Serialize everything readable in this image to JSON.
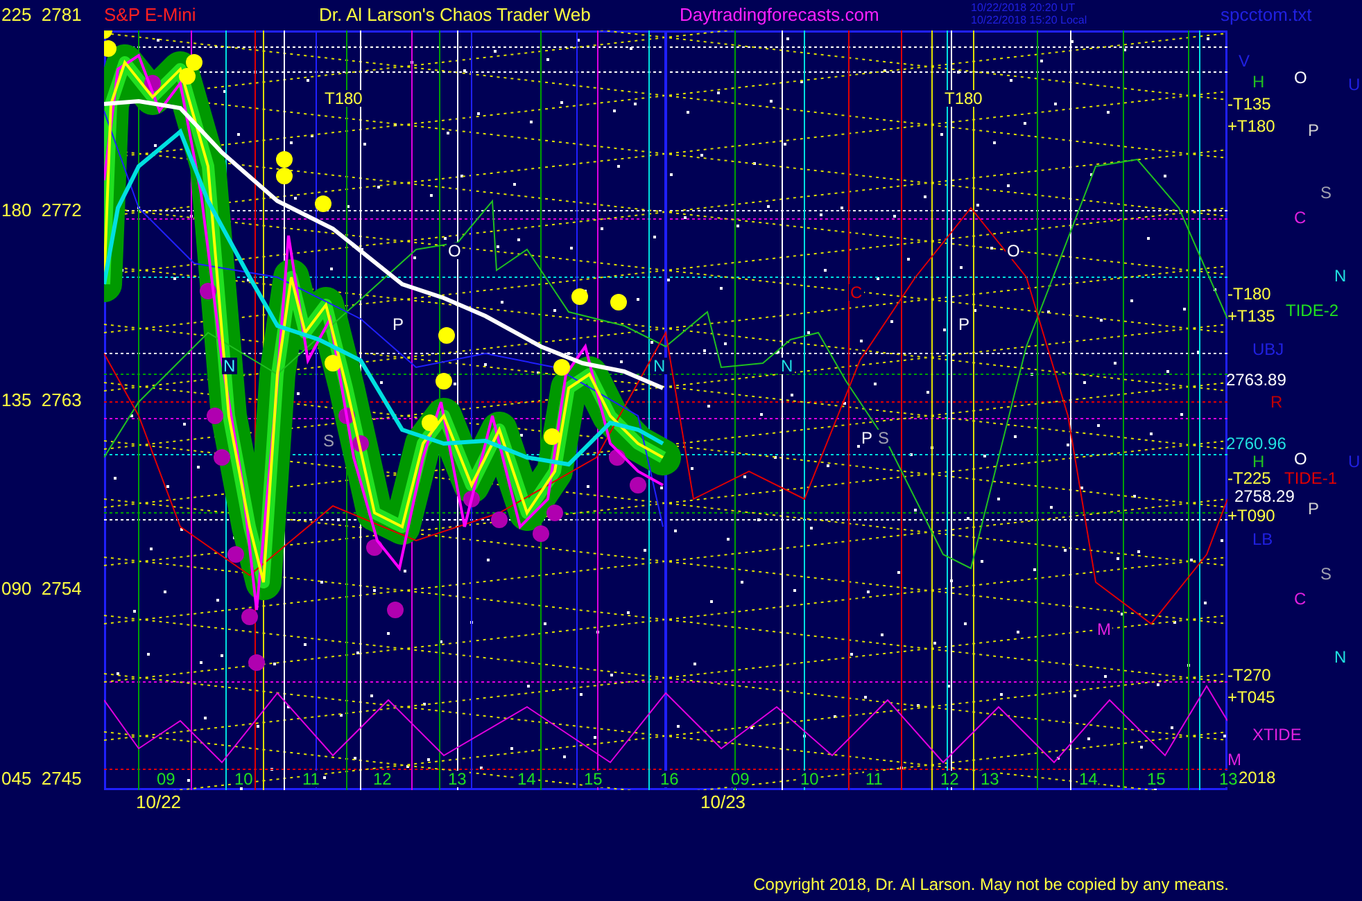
{
  "header": {
    "axis_top": "225  2781",
    "symbol": "S&P E-Mini",
    "title": "Dr. Al Larson's Chaos Trader Web",
    "site": "Daytradingforecasts.com",
    "timestamps": [
      "10/22/2018 20:20 UT",
      "10/22/2018 15:20 Local"
    ],
    "file": "spcctom.txt"
  },
  "y_axis": {
    "labels": [
      "180  2772",
      "135  2763",
      "090  2754",
      "045  2745"
    ]
  },
  "chart_labels": [
    "T180",
    "T180",
    "O",
    "O",
    "P",
    "P",
    "P",
    "N",
    "N",
    "N",
    "S",
    "S",
    "C",
    "M"
  ],
  "hours": [
    "09",
    "10",
    "11",
    "12",
    "13",
    "14",
    "15",
    "16",
    "09",
    "10",
    "11",
    "12",
    "13",
    "14",
    "15",
    "13"
  ],
  "right_labels": [
    {
      "text": "V",
      "color": "#2020e0"
    },
    {
      "text": "H",
      "color": "#20c020"
    },
    {
      "text": "O",
      "color": "#ffffff"
    },
    {
      "text": "U",
      "color": "#2020e0"
    },
    {
      "text": "-T135",
      "color": "#ffff40"
    },
    {
      "text": "+T180",
      "color": "#ffff40"
    },
    {
      "text": "P",
      "color": "#d0d0d0"
    },
    {
      "text": "S",
      "color": "#a0a0b0"
    },
    {
      "text": "C",
      "color": "#e020e0"
    },
    {
      "text": "N",
      "color": "#20e0e0"
    },
    {
      "text": "-T180",
      "color": "#ffff40"
    },
    {
      "text": "+T135",
      "color": "#ffff40"
    },
    {
      "text": "TIDE-2",
      "color": "#20e020"
    },
    {
      "text": "UBJ",
      "color": "#2020e0"
    },
    {
      "text": "2763.89",
      "color": "#ffffff"
    },
    {
      "text": "R",
      "color": "#c00000"
    },
    {
      "text": "2760.96",
      "color": "#20e0e0"
    },
    {
      "text": "H",
      "color": "#20c020"
    },
    {
      "text": "O",
      "color": "#ffffff"
    },
    {
      "text": "U",
      "color": "#2020e0"
    },
    {
      "text": "-T225",
      "color": "#ffff40"
    },
    {
      "text": "TIDE-1",
      "color": "#e00000"
    },
    {
      "text": "2758.29",
      "color": "#ffffff"
    },
    {
      "text": "+T090",
      "color": "#ffff40"
    },
    {
      "text": "P",
      "color": "#d0d0d0"
    },
    {
      "text": "LB",
      "color": "#2020e0"
    },
    {
      "text": "S",
      "color": "#a0a0b0"
    },
    {
      "text": "C",
      "color": "#e020e0"
    },
    {
      "text": "N",
      "color": "#20e0e0"
    },
    {
      "text": "-T270",
      "color": "#ffff40"
    },
    {
      "text": "+T045",
      "color": "#ffff40"
    },
    {
      "text": "XTIDE",
      "color": "#e020e0"
    },
    {
      "text": "M",
      "color": "#e020e0"
    },
    {
      "text": "2018",
      "color": "#ffff40"
    }
  ],
  "dates": [
    "10/22",
    "10/23"
  ],
  "copyright": "Copyright 2018, Dr. Al Larson. May not be copied by any means."
}
